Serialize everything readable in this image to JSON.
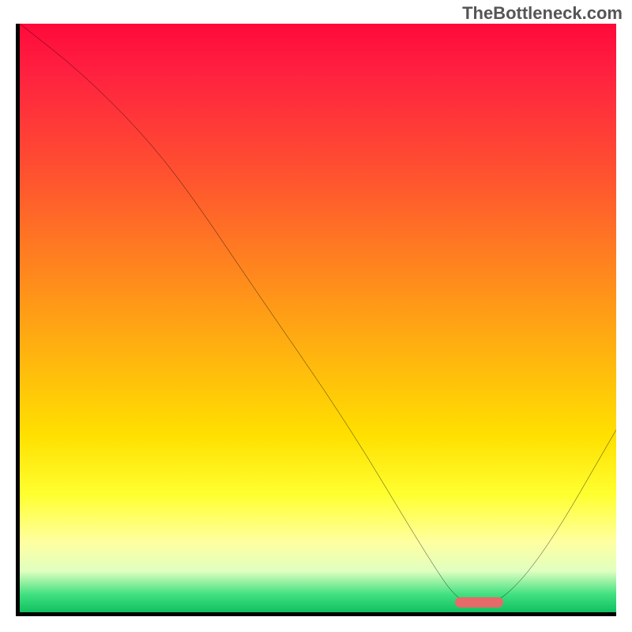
{
  "watermark": "TheBottleneck.com",
  "chart_data": {
    "type": "line",
    "title": "",
    "xlabel": "",
    "ylabel": "",
    "xlim": [
      0,
      100
    ],
    "ylim": [
      0,
      100
    ],
    "grid": false,
    "background_gradient": {
      "stops": [
        {
          "pos": 0,
          "color": "#ff0a3a"
        },
        {
          "pos": 8,
          "color": "#ff2040"
        },
        {
          "pos": 25,
          "color": "#ff5030"
        },
        {
          "pos": 40,
          "color": "#ff8020"
        },
        {
          "pos": 55,
          "color": "#ffb010"
        },
        {
          "pos": 70,
          "color": "#ffe000"
        },
        {
          "pos": 80,
          "color": "#ffff30"
        },
        {
          "pos": 88,
          "color": "#ffffa0"
        },
        {
          "pos": 93,
          "color": "#e0ffc0"
        },
        {
          "pos": 97,
          "color": "#40e080"
        },
        {
          "pos": 100,
          "color": "#10c060"
        }
      ]
    },
    "series": [
      {
        "name": "bottleneck-curve",
        "color": "#000000",
        "x": [
          0,
          10,
          20,
          28,
          40,
          55,
          68,
          74,
          80,
          88,
          100
        ],
        "y": [
          100,
          92,
          82,
          72,
          54,
          32,
          10,
          1,
          1,
          10,
          31
        ]
      }
    ],
    "marker": {
      "name": "optimal-range",
      "color": "#e66a6a",
      "x_start": 73,
      "x_end": 81,
      "y": 0.8
    }
  }
}
